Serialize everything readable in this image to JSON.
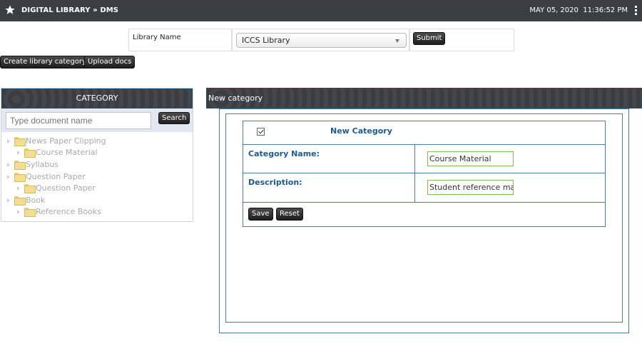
{
  "topbar": {
    "title": "DIGITAL LIBRARY » DMS",
    "date": "MAY 05, 2020",
    "time": "11:36:52 PM"
  },
  "library_selector": {
    "label": "Library Name",
    "selected": "ICCS Library",
    "submit_label": "Submit"
  },
  "actions": {
    "create_category": "Create library category",
    "upload_docs": "Upload docs"
  },
  "category_panel": {
    "title": "CATEGORY",
    "search_placeholder": "Type document name",
    "search_label": "Search",
    "tree": [
      {
        "label": "News Paper Clipping",
        "level": 0
      },
      {
        "label": "Course Material",
        "level": 1
      },
      {
        "label": "Syllabus",
        "level": 0
      },
      {
        "label": "Question Paper",
        "level": 0
      },
      {
        "label": "Question Paper",
        "level": 1
      },
      {
        "label": "Book",
        "level": 0
      },
      {
        "label": "Reference Books",
        "level": 1
      }
    ]
  },
  "new_category_panel": {
    "title": "New category",
    "form_title": "New Category",
    "checkbox_checked": true,
    "category_name_label": "Category Name:",
    "category_name_value": "Course Material",
    "description_label": "Description:",
    "description_value": "Student reference ma",
    "save_label": "Save",
    "reset_label": "Reset"
  },
  "colors": {
    "topbar": "#3b3f44",
    "accent_blue": "#1c5a96",
    "input_border_green": "#7cc24e"
  }
}
